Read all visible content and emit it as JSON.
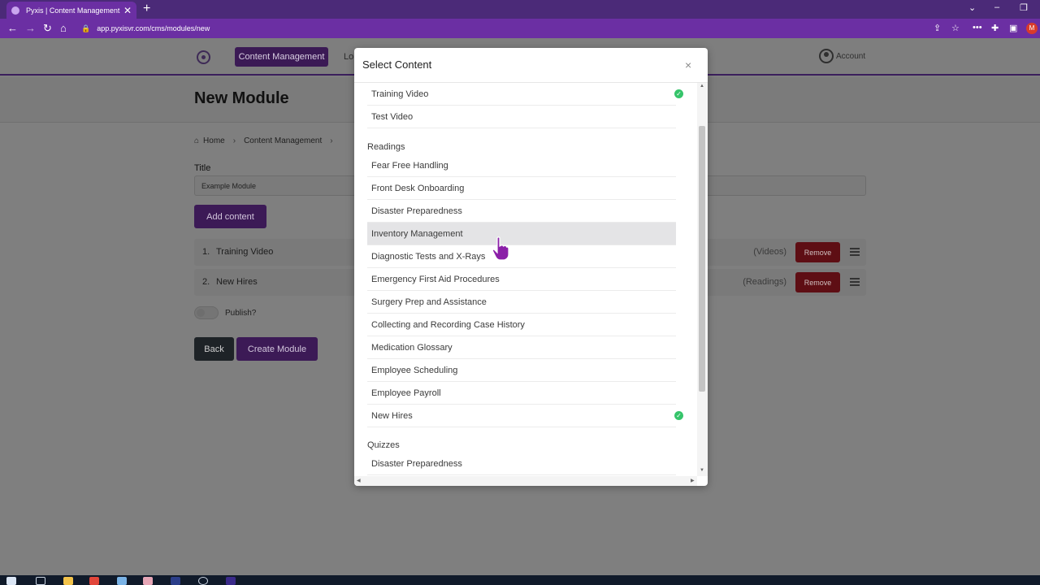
{
  "browser": {
    "tab_title": "Pyxis | Content Management | M",
    "tab_close": "✕",
    "new_tab": "+",
    "url": "app.pyxisvr.com/cms/modules/new",
    "profile_initial": "M",
    "colors": {
      "tabbar": "#4b2a78",
      "addressbar": "#6b2fa3"
    }
  },
  "header": {
    "nav_active": "Content Management",
    "nav_link": "Lo",
    "account_label": "Account",
    "colors": {
      "brand": "#3b1a55"
    }
  },
  "page": {
    "title": "New Module",
    "breadcrumb": [
      "Home",
      "Content Management"
    ],
    "title_field_label": "Title",
    "title_field_value": "Example Module",
    "add_content_label": "Add content",
    "rows": [
      {
        "num": "1.",
        "name": "Training Video",
        "type": "(Videos)",
        "remove": "Remove"
      },
      {
        "num": "2.",
        "name": "New Hires",
        "type": "(Readings)",
        "remove": "Remove"
      }
    ],
    "publish_label": "Publish?",
    "back_label": "Back",
    "create_label": "Create Module",
    "colors": {
      "remove": "#5e0e14",
      "back": "#1e2327"
    }
  },
  "modal": {
    "title": "Select Content",
    "close": "×",
    "videos": [
      {
        "label": "Training Video",
        "selected": true
      },
      {
        "label": "Test Video",
        "selected": false
      }
    ],
    "readings_heading": "Readings",
    "readings": [
      {
        "label": "Fear Free Handling",
        "selected": false
      },
      {
        "label": "Front Desk Onboarding",
        "selected": false
      },
      {
        "label": "Disaster Preparedness",
        "selected": false
      },
      {
        "label": "Inventory Management",
        "selected": false,
        "hovered": true
      },
      {
        "label": "Diagnostic Tests and X-Rays",
        "selected": false
      },
      {
        "label": "Emergency First Aid Procedures",
        "selected": false
      },
      {
        "label": "Surgery Prep and Assistance",
        "selected": false
      },
      {
        "label": "Collecting and Recording Case History",
        "selected": false
      },
      {
        "label": "Medication Glossary",
        "selected": false
      },
      {
        "label": "Employee Scheduling",
        "selected": false
      },
      {
        "label": "Employee Payroll",
        "selected": false
      },
      {
        "label": "New Hires",
        "selected": true
      }
    ],
    "quizzes_heading": "Quizzes",
    "quizzes": [
      {
        "label": "Disaster Preparedness",
        "selected": false
      }
    ],
    "check_glyph": "✓",
    "colors": {
      "check": "#35c46a",
      "hover": "#e4e4e6"
    }
  }
}
